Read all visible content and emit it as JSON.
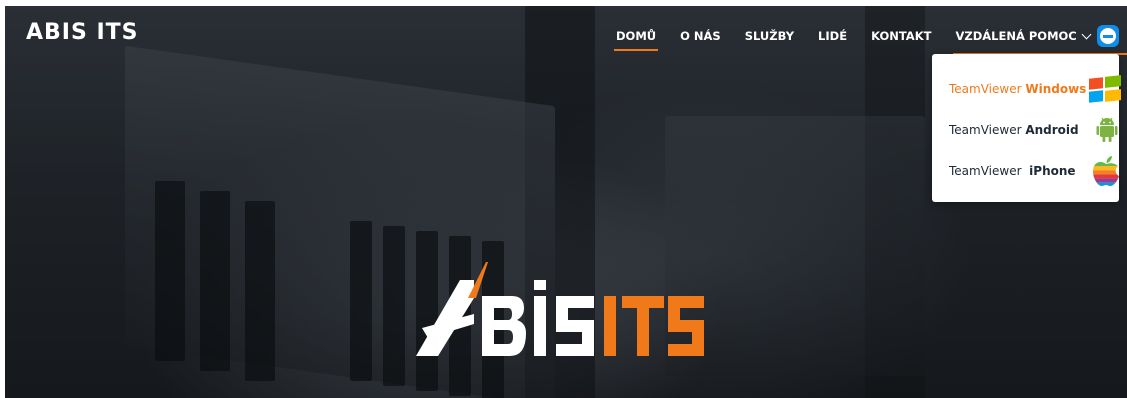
{
  "site": {
    "title": "ABIS ITS"
  },
  "nav": {
    "items": [
      {
        "label": "DOMŮ",
        "active": true
      },
      {
        "label": "O NÁS"
      },
      {
        "label": "SLUŽBY"
      },
      {
        "label": "LIDÉ"
      },
      {
        "label": "KONTAKT"
      }
    ],
    "remote": {
      "label": "VZDÁLENÁ POMOC",
      "icon": "teamviewer-icon",
      "open": true
    }
  },
  "dropdown": {
    "items": [
      {
        "prefix": "TeamViewer",
        "platform": "Windows",
        "icon": "windows-icon",
        "highlighted": true
      },
      {
        "prefix": "TeamViewer",
        "platform": "Android",
        "icon": "android-icon"
      },
      {
        "prefix": "TeamViewer",
        "platform": "iPhone",
        "icon": "apple-icon"
      }
    ]
  },
  "hero": {
    "logo_text": "ABIS ITS",
    "logo_icon": "abis-its-logo"
  },
  "colors": {
    "accent": "#f07a1a",
    "teamviewer": "#0e8ee9",
    "text_dark": "#1e2a36"
  }
}
